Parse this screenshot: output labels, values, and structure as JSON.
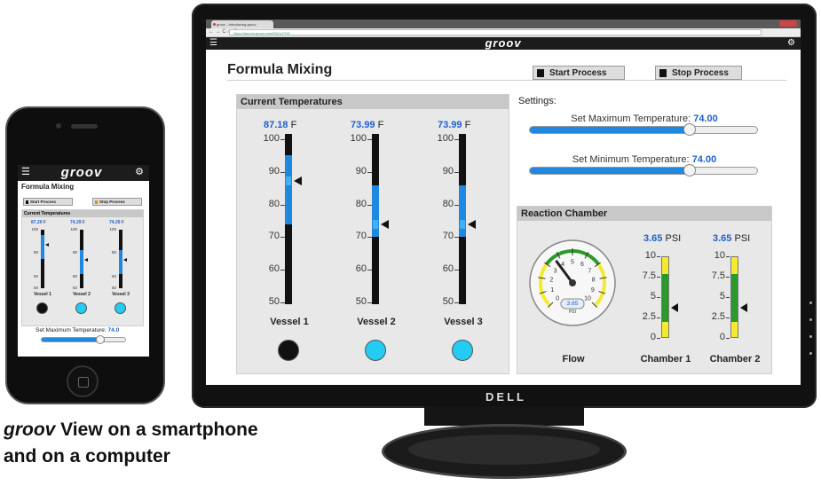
{
  "browser": {
    "tab_title": "groov - Introducing groov",
    "url": "https://launch.groov.com/ENCLPOS",
    "nav_glyphs": "← → C ⌂ 🔒"
  },
  "app": {
    "logo": "groov",
    "menu_icon": "menu-icon",
    "settings_icon": "gear-icon"
  },
  "page": {
    "title": "Formula Mixing",
    "start_button": "Start Process",
    "stop_button": "Stop Process"
  },
  "temperatures": {
    "panel_title": "Current Temperatures",
    "unit": "F",
    "axis_ticks": [
      "100",
      "90",
      "80",
      "70",
      "60",
      "50"
    ],
    "axis_range": [
      50,
      100
    ],
    "vessels": [
      {
        "name": "Vessel 1",
        "value": "87.18",
        "numeric": 87.18,
        "band": [
          74,
          95
        ],
        "light": "black",
        "light_color": "#111111"
      },
      {
        "name": "Vessel 2",
        "value": "73.99",
        "numeric": 73.99,
        "band": [
          70,
          86
        ],
        "light": "cyan",
        "light_color": "#22ccf2"
      },
      {
        "name": "Vessel 3",
        "value": "73.99",
        "numeric": 73.99,
        "band": [
          70,
          86
        ],
        "light": "cyan",
        "light_color": "#22ccf2"
      }
    ]
  },
  "settings": {
    "label": "Settings:",
    "max_label": "Set Maximum Temperature:",
    "max_value": "74.00",
    "max_fraction": 0.7,
    "min_label": "Set Minimum Temperature:",
    "min_value": "74.00",
    "min_fraction": 0.7
  },
  "reaction": {
    "panel_title": "Reaction Chamber",
    "gauge": {
      "name": "Flow",
      "value": "3.65",
      "unit": "PSI",
      "ticks": [
        "0",
        "1",
        "2",
        "3",
        "4",
        "5",
        "6",
        "7",
        "8",
        "9",
        "10"
      ],
      "range": [
        0,
        10
      ],
      "numeric": 3.65
    },
    "chambers": [
      {
        "name": "Chamber 1",
        "value": "3.65",
        "unit": "PSI",
        "numeric": 3.65,
        "ticks": [
          "10",
          "7.5",
          "5",
          "2.5",
          "0"
        ]
      },
      {
        "name": "Chamber 2",
        "value": "3.65",
        "unit": "PSI",
        "numeric": 3.65,
        "ticks": [
          "10",
          "7.5",
          "5",
          "2.5",
          "0"
        ]
      }
    ]
  },
  "monitor": {
    "brand": "DELL"
  },
  "phone": {
    "title": "Formula Mixing",
    "start_button": "Start Process",
    "stop_button": "Stop Process",
    "panel_title": "Current Temperatures",
    "ticks": [
      "100",
      "80",
      "60",
      "50"
    ],
    "vessels": [
      {
        "name": "Vessel 1",
        "value": "87.20",
        "light_color": "#111111"
      },
      {
        "name": "Vessel 2",
        "value": "74.29",
        "light_color": "#22ccf2"
      },
      {
        "name": "Vessel 3",
        "value": "74.29",
        "light_color": "#22ccf2"
      }
    ],
    "slider_label": "Set Maximum Temperature:",
    "slider_value": "74.0",
    "slider_fraction": 0.7
  },
  "caption": {
    "brand": "groov",
    "line1_rest": " View on a smartphone",
    "line2": "and on a computer"
  },
  "colors": {
    "accent_blue": "#1f88e0",
    "value_blue": "#1f5fd0",
    "band_light": "#3fb0f0",
    "gauge_green": "#2a9a2a",
    "gauge_yellow": "#f4ea30"
  }
}
